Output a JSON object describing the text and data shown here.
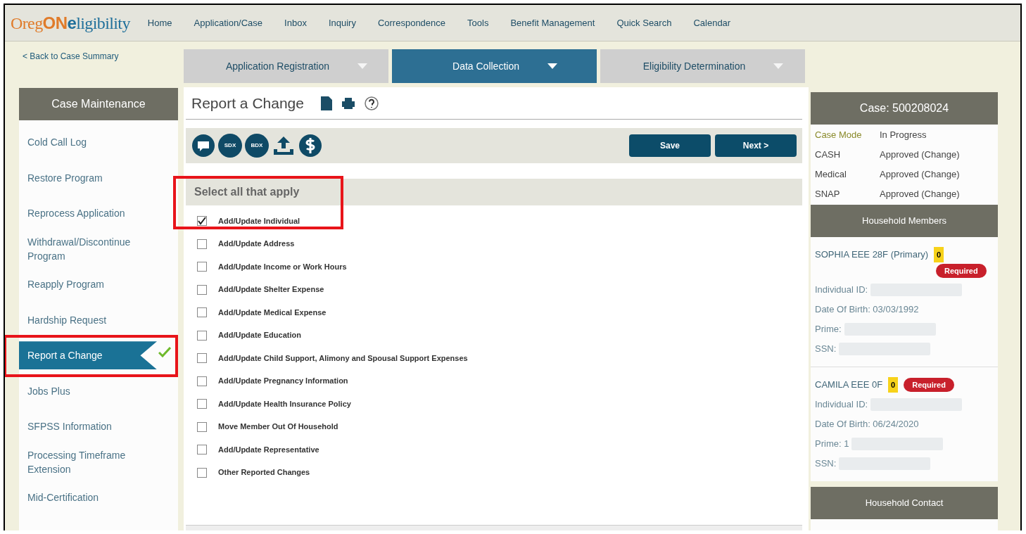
{
  "logo": [
    {
      "text": "Oreg",
      "color": "#e07b2a"
    },
    {
      "text": "ON",
      "color": "#e07b2a"
    },
    {
      "text": "e",
      "color": "#1f6f9a"
    },
    {
      "text": "ligibility",
      "color": "#1f6f9a"
    }
  ],
  "nav": [
    "Home",
    "Application/Case",
    "Inbox",
    "Inquiry",
    "Correspondence",
    "Tools",
    "Benefit Management",
    "Quick Search",
    "Calendar"
  ],
  "back_link": "< Back to Case Summary",
  "steps": [
    {
      "label": "Application Registration",
      "selected": false
    },
    {
      "label": "Data Collection",
      "selected": true
    },
    {
      "label": "Eligibility Determination",
      "selected": false
    }
  ],
  "sidebar": {
    "title": "Case Maintenance",
    "items": [
      {
        "label": "Cold Call Log",
        "selected": false,
        "highlighted": false
      },
      {
        "label": "Restore Program",
        "selected": false,
        "highlighted": false
      },
      {
        "label": "Reprocess Application",
        "selected": false,
        "highlighted": false
      },
      {
        "label": "Withdrawal/Discontinue Program",
        "selected": false,
        "highlighted": false
      },
      {
        "label": "Reapply Program",
        "selected": false,
        "highlighted": false
      },
      {
        "label": "Hardship Request",
        "selected": false,
        "highlighted": false
      },
      {
        "label": "Report a Change",
        "selected": true,
        "highlighted": true
      },
      {
        "label": "Jobs Plus",
        "selected": false,
        "highlighted": false
      },
      {
        "label": "SFPSS Information",
        "selected": false,
        "highlighted": false
      },
      {
        "label": "Processing Timeframe Extension",
        "selected": false,
        "highlighted": false
      },
      {
        "label": "Mid-Certification",
        "selected": false,
        "highlighted": false
      }
    ]
  },
  "page_title": "Report a Change",
  "toolbar": {
    "icons": [
      "SDX",
      "BDX"
    ],
    "buttons": [
      "Save",
      "Next >"
    ]
  },
  "checklist": {
    "heading": "Select all that apply",
    "highlighted": true,
    "items": [
      {
        "label": "Add/Update Individual",
        "checked": true
      },
      {
        "label": "Add/Update Address",
        "checked": false
      },
      {
        "label": "Add/Update Income or Work Hours",
        "checked": false
      },
      {
        "label": "Add/Update Shelter Expense",
        "checked": false
      },
      {
        "label": "Add/Update Medical Expense",
        "checked": false
      },
      {
        "label": "Add/Update Education",
        "checked": false
      },
      {
        "label": "Add/Update Child Support, Alimony and Spousal Support Expenses",
        "checked": false
      },
      {
        "label": "Add/Update Pregnancy Information",
        "checked": false
      },
      {
        "label": "Add/Update Health Insurance Policy",
        "checked": false
      },
      {
        "label": "Move Member Out Of Household",
        "checked": false
      },
      {
        "label": "Add/Update Representative",
        "checked": false
      },
      {
        "label": "Other Reported Changes",
        "checked": false
      }
    ]
  },
  "case": {
    "title": "Case: 500208024",
    "rows": [
      {
        "label": "Case Mode",
        "value": "In Progress"
      },
      {
        "label": "CASH",
        "value": "Approved (Change)"
      },
      {
        "label": "Medical",
        "value": "Approved (Change)"
      },
      {
        "label": "SNAP",
        "value": "Approved (Change)"
      }
    ]
  },
  "household_members": {
    "title": "Household Members",
    "members": [
      {
        "name": "SOPHIA EEE 28F (Primary)",
        "count": "0",
        "badge": "Required",
        "fields": [
          {
            "text": "Individual ID:",
            "redacted": true
          },
          {
            "text": "Date Of Birth: 03/03/1992",
            "redacted": false
          },
          {
            "text": "Prime:",
            "redacted": true
          },
          {
            "text": "SSN:",
            "redacted": true
          }
        ]
      },
      {
        "name": "CAMILA EEE 0F",
        "count": "0",
        "badge": "Required",
        "fields": [
          {
            "text": "Individual ID:",
            "redacted": true
          },
          {
            "text": "Date Of Birth: 06/24/2020",
            "redacted": false
          },
          {
            "text": "Prime: 1",
            "redacted": true
          },
          {
            "text": "SSN:",
            "redacted": true
          }
        ]
      }
    ]
  },
  "household_contact": {
    "title": "Household Contact"
  }
}
